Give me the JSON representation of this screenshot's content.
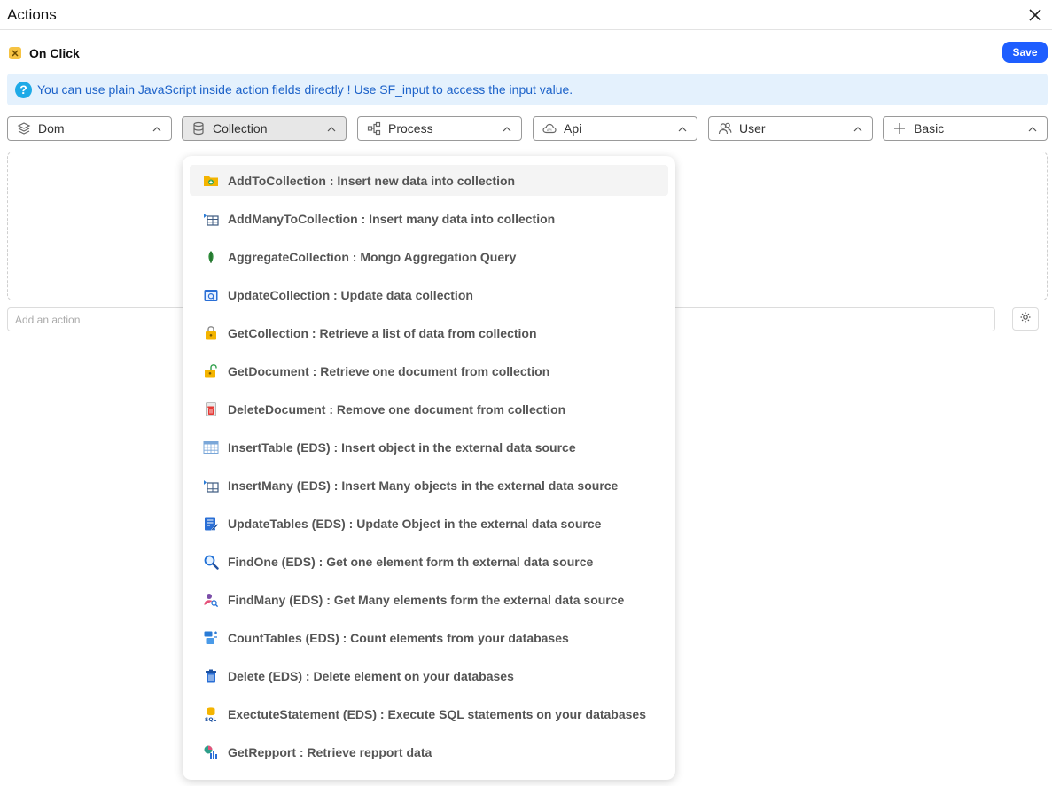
{
  "window": {
    "title": "Actions"
  },
  "event": {
    "label": "On Click"
  },
  "toolbar": {
    "save_label": "Save"
  },
  "info": {
    "text": "You can use plain JavaScript inside action fields directly ! Use SF_input to access the input value."
  },
  "tabs": [
    {
      "label": "Dom",
      "icon": "layers-icon",
      "active": false
    },
    {
      "label": "Collection",
      "icon": "database-icon",
      "active": true
    },
    {
      "label": "Process",
      "icon": "process-icon",
      "active": false
    },
    {
      "label": "Api",
      "icon": "cloud-api-icon",
      "active": false
    },
    {
      "label": "User",
      "icon": "users-icon",
      "active": false
    },
    {
      "label": "Basic",
      "icon": "plus-icon",
      "active": false
    }
  ],
  "action_input": {
    "placeholder": "Add an action",
    "value": ""
  },
  "menu": {
    "items": [
      {
        "label": "AddToCollection : Insert new data into collection",
        "icon": "folder-add-icon"
      },
      {
        "label": "AddManyToCollection : Insert many data into collection",
        "icon": "table-insert-icon"
      },
      {
        "label": "AggregateCollection : Mongo Aggregation Query",
        "icon": "mongo-leaf-icon"
      },
      {
        "label": "UpdateCollection : Update data collection",
        "icon": "calendar-update-icon"
      },
      {
        "label": "GetCollection : Retrieve a list of data from collection",
        "icon": "locked-folder-icon"
      },
      {
        "label": "GetDocument : Retrieve one document from collection",
        "icon": "unlocked-folder-icon"
      },
      {
        "label": "DeleteDocument : Remove one document from collection",
        "icon": "trash-document-icon"
      },
      {
        "label": "InsertTable (EDS) : Insert object in the external data source",
        "icon": "table-icon"
      },
      {
        "label": "InsertMany (EDS) : Insert Many objects in the external data source",
        "icon": "table-insert-icon"
      },
      {
        "label": "UpdateTables (EDS) : Update Object in the external data source",
        "icon": "edit-document-icon"
      },
      {
        "label": "FindOne (EDS) : Get one element form th external data source",
        "icon": "magnifier-icon"
      },
      {
        "label": "FindMany (EDS) : Get Many elements form the external data source",
        "icon": "user-search-icon"
      },
      {
        "label": "CountTables (EDS) : Count elements from your databases",
        "icon": "count-tables-icon"
      },
      {
        "label": "Delete (EDS) : Delete element on your databases",
        "icon": "delete-bin-icon"
      },
      {
        "label": "ExectuteStatement (EDS) : Execute SQL statements on your databases",
        "icon": "sql-database-icon"
      },
      {
        "label": "GetRepport : Retrieve repport data",
        "icon": "report-chart-icon"
      }
    ]
  },
  "colors": {
    "accent": "#1e5eff",
    "info_bg": "#e4f1fd",
    "info_text": "#1c62c9",
    "info_icon": "#1eaae7",
    "event_badge": "#f6c343"
  }
}
